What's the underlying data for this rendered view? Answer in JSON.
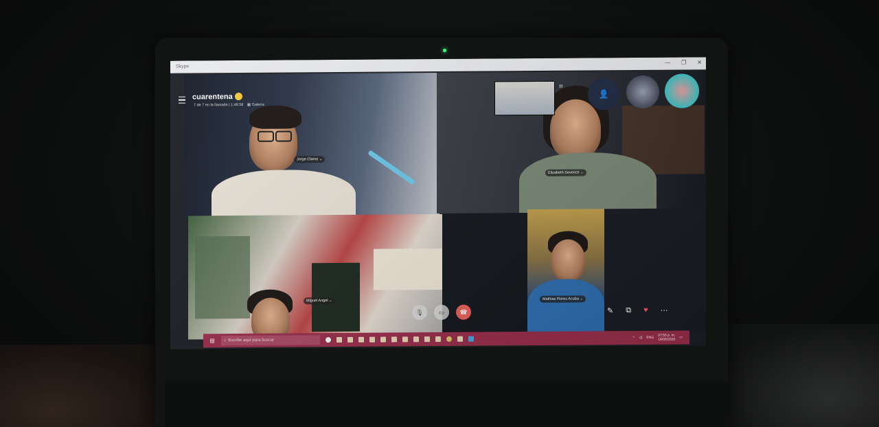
{
  "window": {
    "app_name": "Skype",
    "min": "—",
    "max": "❐",
    "close": "✕"
  },
  "call": {
    "title": "cuarentena",
    "subtitle": "7 de 7 en la llamada | 1:48:58",
    "view_mode": "Galería"
  },
  "participants": [
    {
      "name": "Jorge Claros"
    },
    {
      "name": "Elizabeth Severich"
    },
    {
      "name": "Miguel Angel"
    },
    {
      "name": "Mathias Flores Acuba"
    }
  ],
  "controls": {
    "mic": "🎙",
    "video": "▭",
    "hangup": "☎",
    "chat": "✎",
    "share": "⧉",
    "react": "♥",
    "more": "⋯"
  },
  "taskbar": {
    "search_placeholder": "Escribe aquí para buscar",
    "lang": "ENG",
    "time": "07:55 p. m.",
    "date": "18/05/2020"
  }
}
